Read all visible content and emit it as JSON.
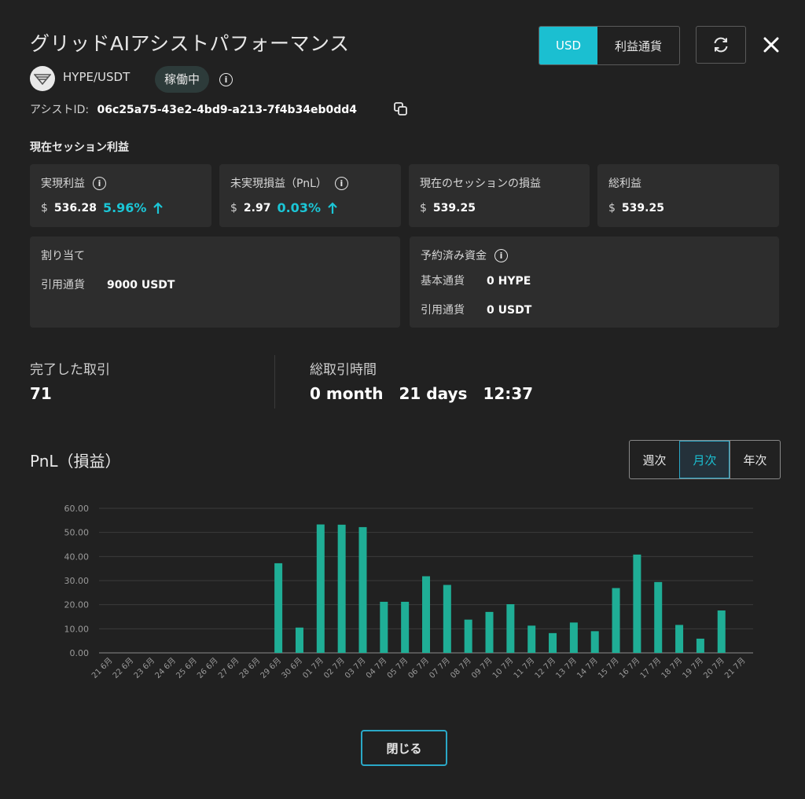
{
  "header": {
    "title": "グリッドAIアシストパフォーマンス",
    "pair": "HYPE/USDT",
    "status": "稼働中",
    "assist_id_label": "アシストID:",
    "assist_id": "06c25a75-43e2-4bd9-a213-7f4b34eb0dd4",
    "currency_usd": "USD",
    "currency_profit": "利益通貨"
  },
  "session": {
    "title": "現在セッション利益",
    "realized": {
      "label": "実現利益",
      "currency": "$",
      "value": "536.28",
      "pct": "5.96%"
    },
    "unrealized": {
      "label": "未実現損益（PnL）",
      "currency": "$",
      "value": "2.97",
      "pct": "0.03%"
    },
    "session_pnl": {
      "label": "現在のセッションの損益",
      "currency": "$",
      "value": "539.25"
    },
    "total": {
      "label": "総利益",
      "currency": "$",
      "value": "539.25"
    },
    "allocation": {
      "label": "割り当て",
      "quote_label": "引用通貨",
      "quote_value": "9000 USDT"
    },
    "reserved": {
      "label": "予約済み資金",
      "base_label": "基本通貨",
      "base_value": "0 HYPE",
      "quote_label": "引用通貨",
      "quote_value": "0 USDT"
    }
  },
  "stats": {
    "trades_label": "完了した取引",
    "trades_value": "71",
    "time_label": "総取引時間",
    "months": "0 month",
    "days": "21 days",
    "clock": "12:37"
  },
  "pnl": {
    "title": "PnL（損益）",
    "periods": [
      "週次",
      "月次",
      "年次"
    ],
    "selected": "月次"
  },
  "footer": {
    "close_label": "閉じる"
  },
  "colors": {
    "accent": "#1bbfd1",
    "bar": "#1fae96",
    "background": "#212121",
    "card": "#2d2d2d"
  },
  "icons": [
    "hype-logo-icon",
    "info-icon",
    "copy-icon",
    "refresh-icon",
    "close-icon",
    "arrow-up-icon"
  ],
  "chart_data": {
    "type": "bar",
    "title": "",
    "xlabel": "",
    "ylabel": "",
    "ylim": [
      0,
      60
    ],
    "yticks": [
      "0.00",
      "10.00",
      "20.00",
      "30.00",
      "40.00",
      "50.00",
      "60.00"
    ],
    "grid": true,
    "categories": [
      "21 6月",
      "22 6月",
      "23 6月",
      "24 6月",
      "25 6月",
      "26 6月",
      "27 6月",
      "28 6月",
      "29 6月",
      "30 6月",
      "01 7月",
      "02 7月",
      "03 7月",
      "04 7月",
      "05 7月",
      "06 7月",
      "07 7月",
      "08 7月",
      "09 7月",
      "10 7月",
      "11 7月",
      "12 7月",
      "13 7月",
      "14 7月",
      "15 7月",
      "16 7月",
      "17 7月",
      "18 7月",
      "19 7月",
      "20 7月",
      "21 7月"
    ],
    "values": [
      0,
      0,
      0,
      0,
      0,
      0,
      0,
      0,
      37.2,
      10.5,
      53.3,
      53.2,
      52.2,
      21.2,
      21.2,
      31.8,
      28.2,
      13.8,
      17.0,
      20.2,
      11.3,
      8.2,
      12.6,
      9.0,
      26.9,
      40.8,
      29.4,
      11.6,
      5.9,
      17.6,
      0
    ]
  }
}
